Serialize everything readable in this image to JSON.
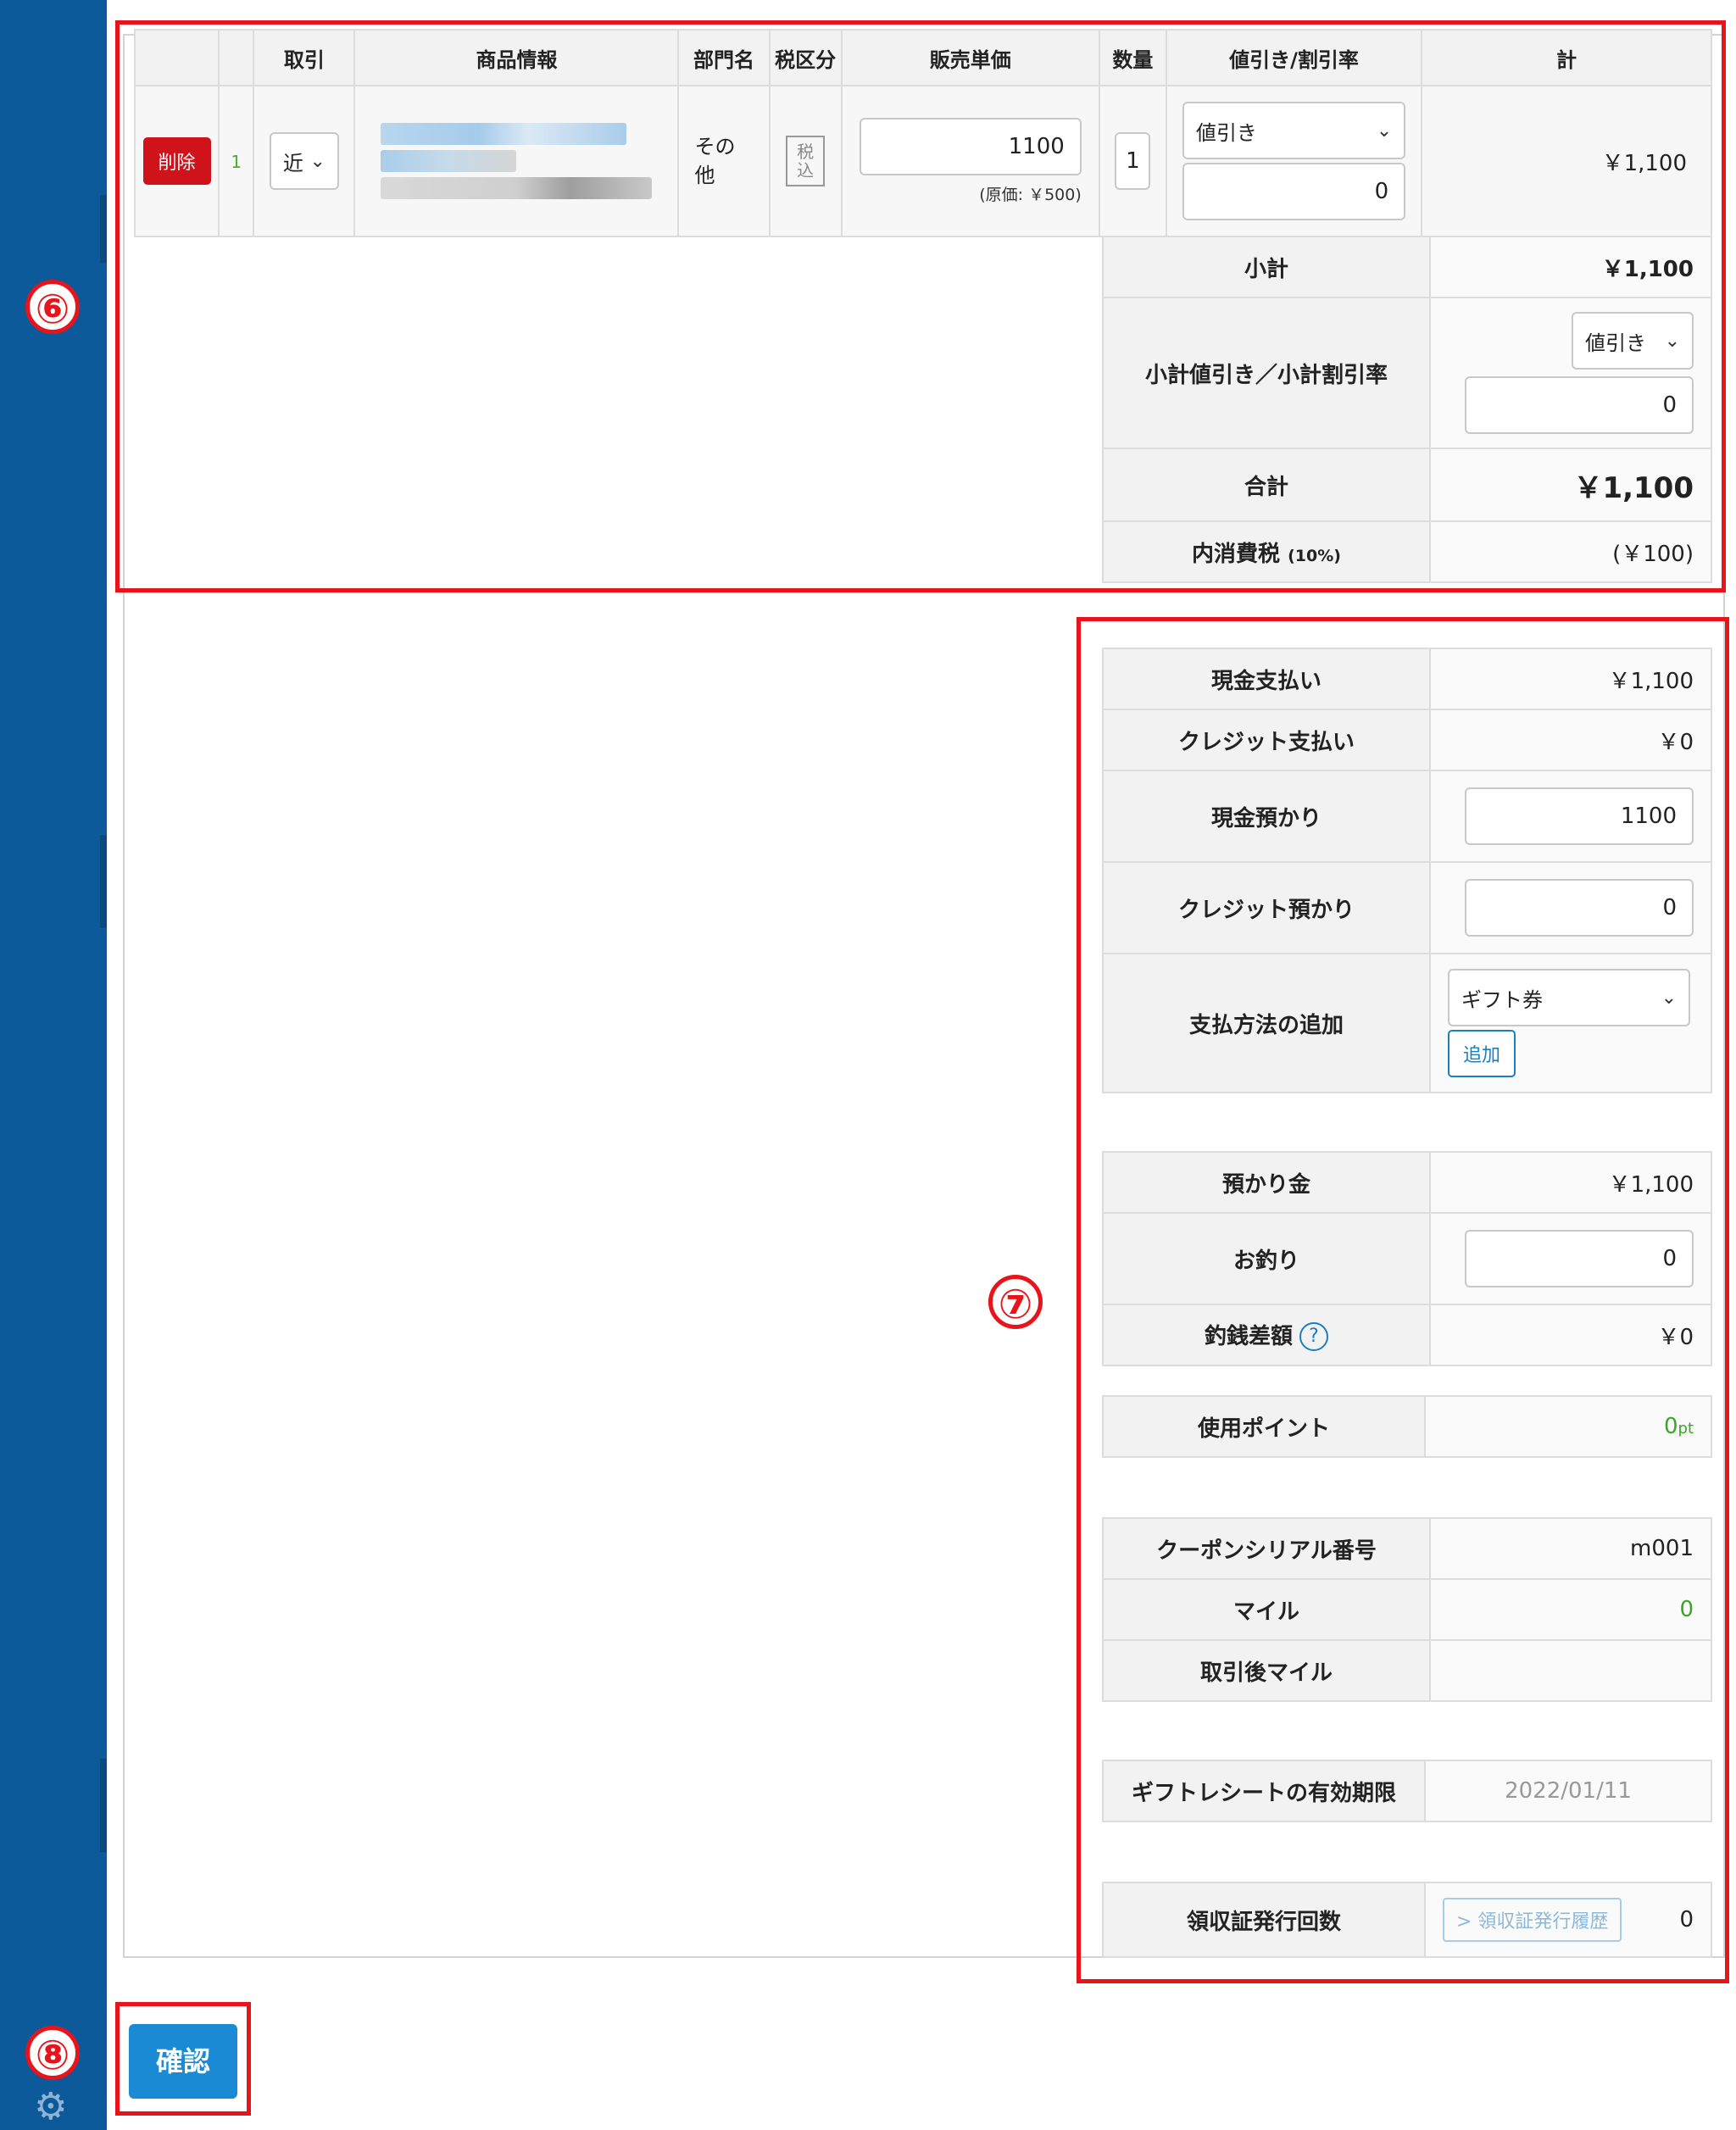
{
  "annotations": {
    "six": "⑥",
    "seven": "⑦",
    "eight": "⑧"
  },
  "table": {
    "headers": [
      "",
      "",
      "取引",
      "商品情報",
      "部門名",
      "税区分",
      "販売単価",
      "数量",
      "値引き/割引率",
      "計"
    ],
    "row": {
      "delete_label": "削除",
      "number": "1",
      "transaction": "近",
      "department": "その他",
      "tax_label": "税込",
      "unit_price": "1100",
      "cost_note": "(原価: ￥500)",
      "quantity": "1",
      "discount_type": "値引き",
      "discount_value": "0",
      "total": "￥1,100"
    }
  },
  "summary": {
    "subtotal_label": "小計",
    "subtotal_value": "￥1,100",
    "subtotal_discount_label": "小計値引き／小計割引率",
    "subtotal_discount_type": "値引き",
    "subtotal_discount_value": "0",
    "total_label": "合計",
    "total_value": "￥1,100",
    "tax_label": "内消費税",
    "tax_rate": "(10%)",
    "tax_value": "(￥100)"
  },
  "payment": {
    "cash_pay_label": "現金支払い",
    "cash_pay_value": "￥1,100",
    "credit_pay_label": "クレジット支払い",
    "credit_pay_value": "￥0",
    "cash_deposit_label": "現金預かり",
    "cash_deposit_value": "1100",
    "credit_deposit_label": "クレジット預かり",
    "credit_deposit_value": "0",
    "add_method_label": "支払方法の追加",
    "add_method_select": "ギフト券",
    "add_button": "追加",
    "deposit_label": "預かり金",
    "deposit_value": "￥1,100",
    "change_label": "お釣り",
    "change_value": "0",
    "change_diff_label": "釣銭差額",
    "change_diff_help": "?",
    "change_diff_value": "￥0",
    "points_label": "使用ポイント",
    "points_value": "0",
    "points_unit": "pt",
    "coupon_label": "クーポンシリアル番号",
    "coupon_value": "m001",
    "mile_label": "マイル",
    "mile_value": "0",
    "after_mile_label": "取引後マイル",
    "after_mile_value": "",
    "gift_expiry_label": "ギフトレシートの有効期限",
    "gift_expiry_value": "2022/01/11",
    "receipt_count_label": "領収証発行回数",
    "receipt_history_button": "> 領収証発行履歴",
    "receipt_count_value": "0"
  },
  "confirm_button": "確認",
  "colors": {
    "sidebar": "#0c5a99",
    "annotation": "#e8141b",
    "accent": "#1a8ad4",
    "danger": "#d0121b",
    "green": "#3aa628"
  },
  "icons": [
    "settings-gear-icon",
    "chevron-down-icon",
    "help-question-icon"
  ]
}
